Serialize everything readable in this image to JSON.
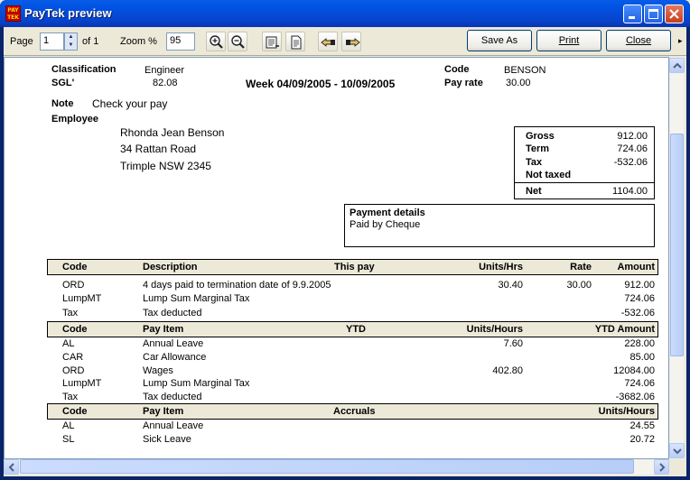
{
  "window": {
    "title": "PayTek preview",
    "icon_text": "PAY TEK"
  },
  "toolbar": {
    "page_label": "Page",
    "page_value": "1",
    "of_label": "of 1",
    "zoom_label": "Zoom %",
    "zoom_value": "95",
    "save_as_label": "Save As",
    "print_label": "Print",
    "close_label": "Close",
    "icons": [
      "zoom-in-icon",
      "zoom-out-icon",
      "page-width-icon",
      "whole-page-icon",
      "previous-page-icon",
      "next-page-icon"
    ]
  },
  "report": {
    "classification_label": "Classification",
    "classification_value": "Engineer",
    "sgl_label": "SGL'",
    "sgl_value": "82.08",
    "week_text": "Week 04/09/2005 - 10/09/2005",
    "code_label": "Code",
    "code_value": "BENSON",
    "payrate_label": "Pay rate",
    "payrate_value": "30.00",
    "note_label": "Note",
    "note_value": "Check your pay",
    "employee_label": "Employee",
    "employee_name": "Rhonda Jean Benson",
    "address_line1": "34 Rattan Road",
    "address_line2": "Trimple NSW 2345",
    "summary": {
      "gross_label": "Gross",
      "gross_value": "912.00",
      "term_label": "Term",
      "term_value": "724.06",
      "tax_label": "Tax",
      "tax_value": "-532.06",
      "not_taxed_label": "Not taxed",
      "net_label": "Net",
      "net_value": "1104.00"
    },
    "payment_details_label": "Payment details",
    "payment_details_value": "Paid by Cheque",
    "this_pay": {
      "headers": {
        "code": "Code",
        "description": "Description",
        "section": "This pay",
        "units": "Units/Hrs",
        "rate": "Rate",
        "amount": "Amount"
      },
      "rows": [
        {
          "code": "ORD",
          "description": "4 days paid to termination date of 9.9.2005",
          "units": "30.40",
          "rate": "30.00",
          "amount": "912.00"
        },
        {
          "code": "LumpMT",
          "description": "Lump Sum Marginal Tax",
          "units": "",
          "rate": "",
          "amount": "724.06"
        },
        {
          "code": "Tax",
          "description": "Tax deducted",
          "units": "",
          "rate": "",
          "amount": "-532.06"
        }
      ]
    },
    "ytd": {
      "headers": {
        "code": "Code",
        "item": "Pay Item",
        "section": "YTD",
        "units": "Units/Hours",
        "amount": "YTD Amount"
      },
      "rows": [
        {
          "code": "AL",
          "item": "Annual Leave",
          "units": "7.60",
          "amount": "228.00"
        },
        {
          "code": "CAR",
          "item": "Car Allowance",
          "units": "",
          "amount": "85.00"
        },
        {
          "code": "ORD",
          "item": "Wages",
          "units": "402.80",
          "amount": "12084.00"
        },
        {
          "code": "LumpMT",
          "item": "Lump Sum Marginal Tax",
          "units": "",
          "amount": "724.06"
        },
        {
          "code": "Tax",
          "item": "Tax deducted",
          "units": "",
          "amount": "-3682.06"
        }
      ]
    },
    "accruals": {
      "headers": {
        "code": "Code",
        "item": "Pay Item",
        "section": "Accruals",
        "units": "Units/Hours"
      },
      "rows": [
        {
          "code": "AL",
          "item": "Annual Leave",
          "units": "24.55"
        },
        {
          "code": "SL",
          "item": "Sick Leave",
          "units": "20.72"
        }
      ]
    }
  }
}
